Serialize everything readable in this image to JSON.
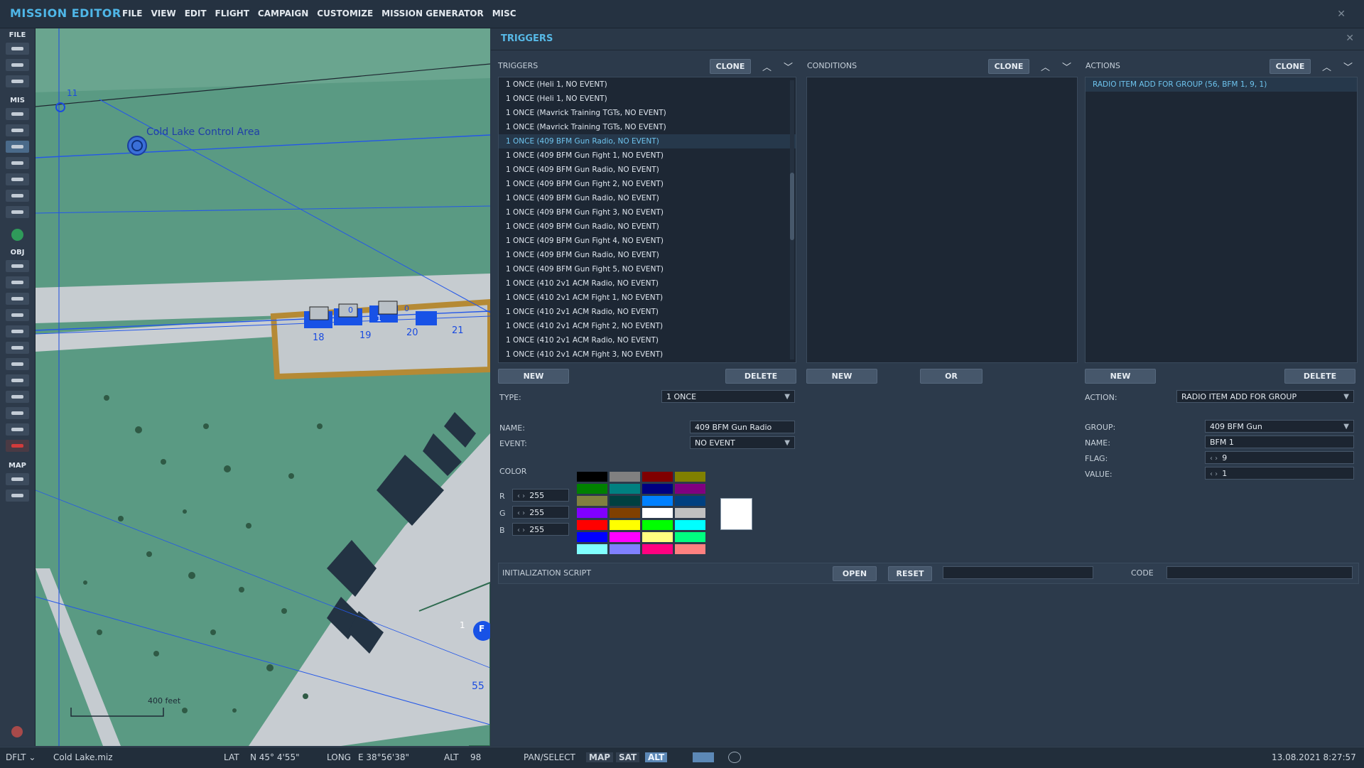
{
  "app": {
    "title": "MISSION EDITOR",
    "menu": [
      "FILE",
      "VIEW",
      "EDIT",
      "FLIGHT",
      "CAMPAIGN",
      "CUSTOMIZE",
      "MISSION GENERATOR",
      "MISC"
    ]
  },
  "toolbar": {
    "sections": [
      "FILE",
      "MIS",
      "OBJ",
      "MAP"
    ]
  },
  "map": {
    "area_label": "Cold Lake Control Area",
    "waypoint_number": "11",
    "parking_numbers": [
      "18",
      "19",
      "20",
      "21"
    ],
    "small_labels": [
      "0",
      "0",
      "1"
    ],
    "runway_marker": "F",
    "runway_number_left": "1",
    "taxi_number": "55",
    "scale_label": "400 feet"
  },
  "panel": {
    "title": "TRIGGERS",
    "triggers": {
      "label": "TRIGGERS",
      "clone": "CLONE",
      "new": "NEW",
      "delete": "DELETE",
      "selected_index": 4,
      "items": [
        "1 ONCE (Heli 1, NO EVENT)",
        "1 ONCE (Heli 1, NO EVENT)",
        "1 ONCE (Mavrick Training TGTs, NO EVENT)",
        "1 ONCE (Mavrick Training TGTs, NO EVENT)",
        "1 ONCE (409 BFM Gun Radio, NO EVENT)",
        "1 ONCE (409 BFM Gun Fight 1, NO EVENT)",
        "1 ONCE (409 BFM Gun Radio, NO EVENT)",
        "1 ONCE (409 BFM Gun Fight 2, NO EVENT)",
        "1 ONCE (409 BFM Gun Radio, NO EVENT)",
        "1 ONCE (409 BFM Gun Fight 3, NO EVENT)",
        "1 ONCE (409 BFM Gun Radio, NO EVENT)",
        "1 ONCE (409 BFM Gun Fight 4, NO EVENT)",
        "1 ONCE (409 BFM Gun Radio, NO EVENT)",
        "1 ONCE (409 BFM Gun Fight 5, NO EVENT)",
        "1 ONCE (410 2v1 ACM Radio, NO EVENT)",
        "1 ONCE (410 2v1 ACM Fight 1, NO EVENT)",
        "1 ONCE (410 2v1 ACM Radio, NO EVENT)",
        "1 ONCE (410 2v1 ACM Fight 2, NO EVENT)",
        "1 ONCE (410 2v1 ACM Radio, NO EVENT)",
        "1 ONCE (410 2v1 ACM Fight 3, NO EVENT)"
      ]
    },
    "conditions": {
      "label": "CONDITIONS",
      "clone": "CLONE",
      "new": "NEW",
      "or": "OR"
    },
    "actions": {
      "label": "ACTIONS",
      "clone": "CLONE",
      "new": "NEW",
      "delete": "DELETE",
      "items": [
        "RADIO ITEM ADD FOR GROUP (56, BFM 1, 9, 1)"
      ]
    },
    "trigger_props": {
      "type_label": "TYPE:",
      "type_value": "1 ONCE",
      "name_label": "NAME:",
      "name_value": "409 BFM Gun Radio",
      "event_label": "EVENT:",
      "event_value": "NO EVENT",
      "color_label": "COLOR",
      "r_label": "R",
      "r_value": "255",
      "g_label": "G",
      "g_value": "255",
      "b_label": "B",
      "b_value": "255"
    },
    "action_props": {
      "action_label": "ACTION:",
      "action_value": "RADIO ITEM ADD FOR GROUP",
      "group_label": "GROUP:",
      "group_value": "409 BFM Gun",
      "name_label": "NAME:",
      "name_value": "BFM 1",
      "flag_label": "FLAG:",
      "flag_value": "9",
      "value_label": "VALUE:",
      "value_value": "1"
    },
    "init_script": {
      "label": "INITIALIZATION SCRIPT",
      "open": "OPEN",
      "reset": "RESET",
      "code_label": "CODE"
    },
    "palette_colors": [
      "#000000",
      "#808080",
      "#800000",
      "#808000",
      "#008000",
      "#008080",
      "#000080",
      "#800080",
      "#808040",
      "#004040",
      "#0080ff",
      "#004080",
      "#8000ff",
      "#804000",
      "#ffffff",
      "#c0c0c0",
      "#ff0000",
      "#ffff00",
      "#00ff00",
      "#00ffff",
      "#0000ff",
      "#ff00ff",
      "#ffff80",
      "#00ff80",
      "#80ffff",
      "#8080ff",
      "#ff0080",
      "#ff8080"
    ]
  },
  "status": {
    "profile": "DFLT",
    "file": "Cold Lake.miz",
    "lat_label": "LAT",
    "lat_value": "N 45° 4'55\"",
    "long_label": "LONG",
    "long_value": "E 38°56'38\"",
    "alt_label": "ALT",
    "alt_value": "98",
    "mode": "PAN/SELECT",
    "map_btn": "MAP",
    "sat_btn": "SAT",
    "alt_btn": "ALT",
    "datetime": "13.08.2021 8:27:57"
  }
}
